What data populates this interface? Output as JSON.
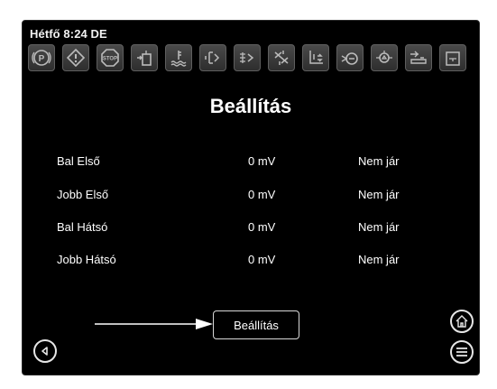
{
  "status": {
    "datetime": "Hétfő 8:24 DE"
  },
  "toolbar": {
    "icons": [
      "parking-brake-icon",
      "warning-icon",
      "stop-icon",
      "fluid-level-icon",
      "coolant-icon",
      "fuel-filter-icon",
      "fuel-injection-icon",
      "engine-fan-icon",
      "transmission-icon",
      "brake-pressure-icon",
      "oil-pressure-icon",
      "hydraulic-icon",
      "battery-icon"
    ]
  },
  "main": {
    "title": "Beállítás",
    "rows": [
      {
        "name": "Bal Első",
        "value": "0 mV",
        "status": "Nem jár"
      },
      {
        "name": "Jobb Első",
        "value": "0 mV",
        "status": "Nem jár"
      },
      {
        "name": "Bal Hátsó",
        "value": "0 mV",
        "status": "Nem jár"
      },
      {
        "name": "Jobb Hátsó",
        "value": "0 mV",
        "status": "Nem jár"
      }
    ],
    "setup_button": "Beállítás"
  },
  "nav": {
    "back": "back-icon",
    "home": "home-icon",
    "menu": "menu-icon"
  }
}
